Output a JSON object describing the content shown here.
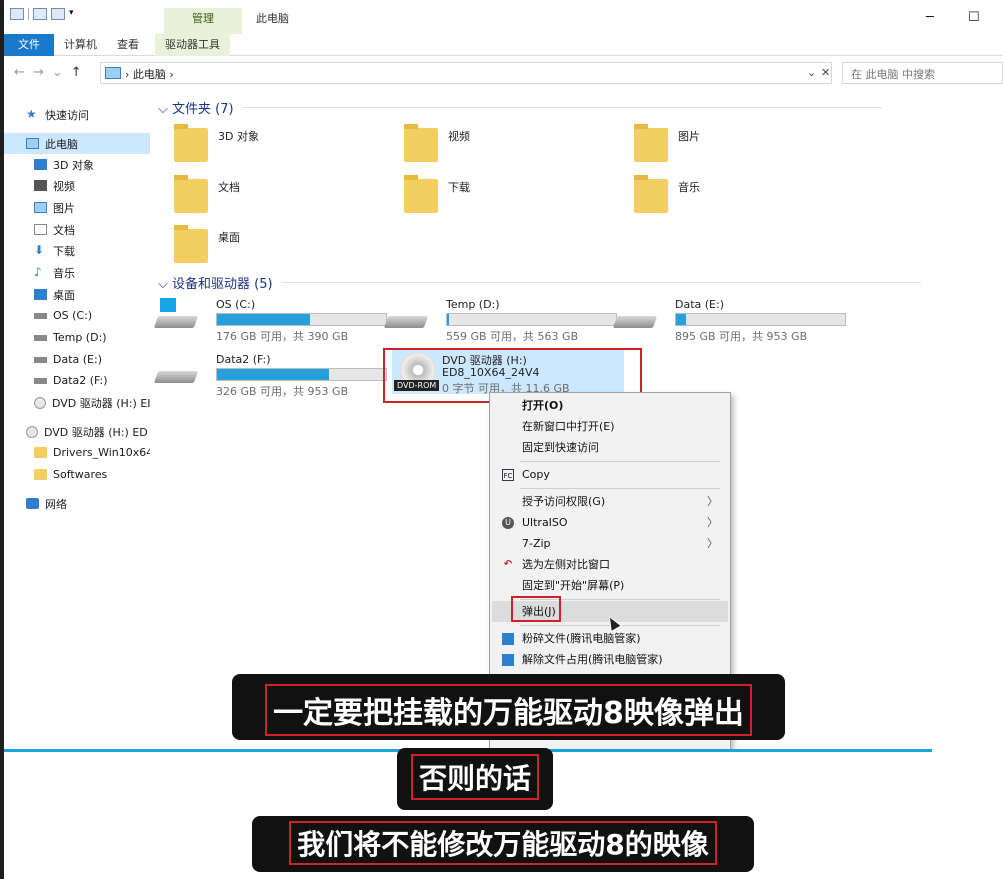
{
  "titlebar": {
    "manage_tab": "管理",
    "title": "此电脑",
    "minimize": "─",
    "maximize": "☐"
  },
  "ribbon": {
    "tabs": [
      "文件",
      "计算机",
      "查看",
      "驱动器工具"
    ]
  },
  "address": {
    "nav": [
      "←",
      "→",
      "⌄",
      "↑"
    ],
    "crumb": "› 此电脑 ›",
    "dropdown": "⌄",
    "clear": "✕",
    "search_placeholder": "在 此电脑 中搜索"
  },
  "sidebar": {
    "items": [
      {
        "label": "快速访问",
        "icon": "star-icon"
      },
      {
        "label": "此电脑",
        "icon": "computer-icon",
        "selected": true
      },
      {
        "label": "3D 对象",
        "icon": "3d-object-icon"
      },
      {
        "label": "视频",
        "icon": "video-icon"
      },
      {
        "label": "图片",
        "icon": "picture-icon"
      },
      {
        "label": "文档",
        "icon": "document-icon"
      },
      {
        "label": "下载",
        "icon": "download-icon"
      },
      {
        "label": "音乐",
        "icon": "music-icon"
      },
      {
        "label": "桌面",
        "icon": "desktop-icon"
      },
      {
        "label": "OS (C:)",
        "icon": "windows-drive-icon"
      },
      {
        "label": "Temp (D:)",
        "icon": "drive-icon"
      },
      {
        "label": "Data (E:)",
        "icon": "drive-icon"
      },
      {
        "label": "Data2 (F:)",
        "icon": "drive-icon"
      },
      {
        "label": "DVD 驱动器 (H:) EI",
        "icon": "dvd-icon"
      },
      {
        "label": "DVD 驱动器 (H:) ED",
        "icon": "dvd-icon"
      },
      {
        "label": "Drivers_Win10x64",
        "icon": "folder-icon"
      },
      {
        "label": "Softwares",
        "icon": "folder-icon"
      },
      {
        "label": "网络",
        "icon": "network-icon"
      }
    ]
  },
  "content": {
    "folders_heading": "文件夹 (7)",
    "folders": [
      "3D 对象",
      "视频",
      "图片",
      "文档",
      "下载",
      "音乐",
      "桌面"
    ],
    "drives_heading": "设备和驱动器 (5)",
    "drives": [
      {
        "name": "OS (C:)",
        "free": "176 GB 可用，共 390 GB",
        "used_fraction": 0.55
      },
      {
        "name": "Temp (D:)",
        "free": "559 GB 可用，共 563 GB",
        "used_fraction": 0.01
      },
      {
        "name": "Data (E:)",
        "free": "895 GB 可用，共 953 GB",
        "used_fraction": 0.06
      },
      {
        "name": "Data2 (F:)",
        "free": "326 GB 可用，共 953 GB",
        "used_fraction": 0.66
      }
    ],
    "dvd": {
      "name": "DVD 驱动器 (H:)",
      "label": "ED8_10X64_24V4",
      "free": "0 字节 可用，共 11.6 GB",
      "tag": "DVD-ROM"
    }
  },
  "context_menu": {
    "items": [
      {
        "label": "打开(O)",
        "bold": true
      },
      {
        "label": "在新窗口中打开(E)"
      },
      {
        "label": "固定到快速访问"
      },
      {
        "label": "Copy",
        "icon": "fc-copy-icon"
      },
      {
        "label": "授予访问权限(G)",
        "submenu": true
      },
      {
        "label": "UltraISO",
        "icon": "ultraiso-icon",
        "submenu": true
      },
      {
        "label": "7-Zip",
        "submenu": true
      },
      {
        "label": "选为左侧对比窗口",
        "icon": "compare-icon"
      },
      {
        "label": "固定到\"开始\"屏幕(P)"
      },
      {
        "label": "弹出(J)",
        "highlighted": true
      },
      {
        "label": "粉碎文件(腾讯电脑管家)",
        "icon": "shred-icon"
      },
      {
        "label": "解除文件占用(腾讯电脑管家)",
        "icon": "unlock-icon"
      }
    ],
    "submenu_arrow": "〉"
  },
  "subtitles": {
    "line1": "一定要把挂载的万能驱动8映像弹出",
    "line2": "否则的话",
    "line3": "我们将不能修改万能驱动8的映像"
  }
}
